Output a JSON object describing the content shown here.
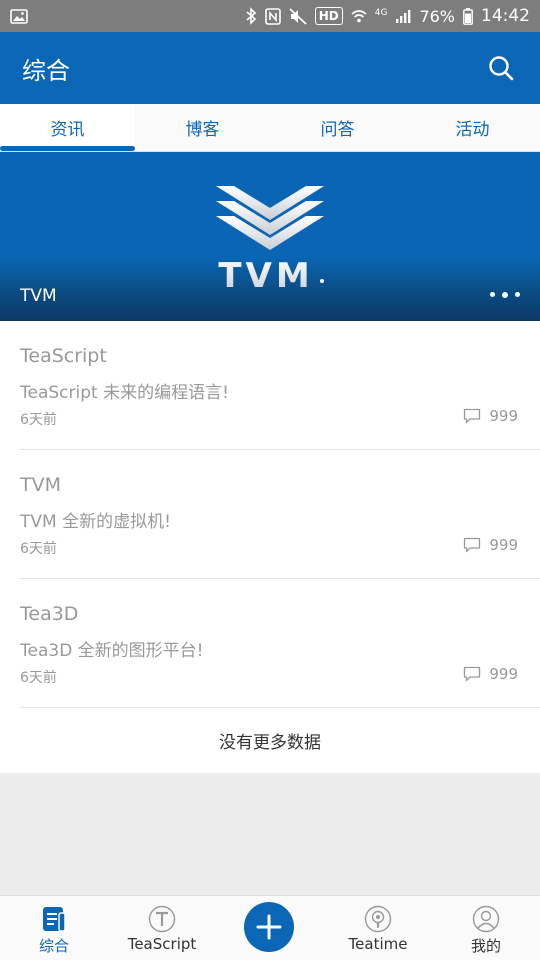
{
  "status_bar": {
    "battery": "76%",
    "time": "14:42",
    "network": "4G",
    "hd": "HD"
  },
  "header": {
    "title": "综合"
  },
  "tabs": [
    {
      "label": "资讯",
      "active": true
    },
    {
      "label": "博客",
      "active": false
    },
    {
      "label": "问答",
      "active": false
    },
    {
      "label": "活动",
      "active": false
    }
  ],
  "banner": {
    "logo_text": "TVM",
    "caption": "TVM"
  },
  "news": [
    {
      "title": "TeaScript",
      "desc": "TeaScript 未来的编程语言!",
      "time": "6天前",
      "comments": "999"
    },
    {
      "title": "TVM",
      "desc": "TVM 全新的虚拟机!",
      "time": "6天前",
      "comments": "999"
    },
    {
      "title": "Tea3D",
      "desc": "Tea3D 全新的图形平台!",
      "time": "6天前",
      "comments": "999"
    }
  ],
  "list_footer": "没有更多数据",
  "bottom_nav": [
    {
      "label": "综合",
      "icon": "news-icon",
      "active": true
    },
    {
      "label": "TeaScript",
      "icon": "teascript-icon",
      "active": false
    },
    {
      "label": "Teatime",
      "icon": "podcast-icon",
      "active": false
    },
    {
      "label": "我的",
      "icon": "profile-icon",
      "active": false
    }
  ],
  "colors": {
    "primary": "#0b67b5",
    "status_bar": "#7d7d7d",
    "muted_text": "#999999"
  }
}
